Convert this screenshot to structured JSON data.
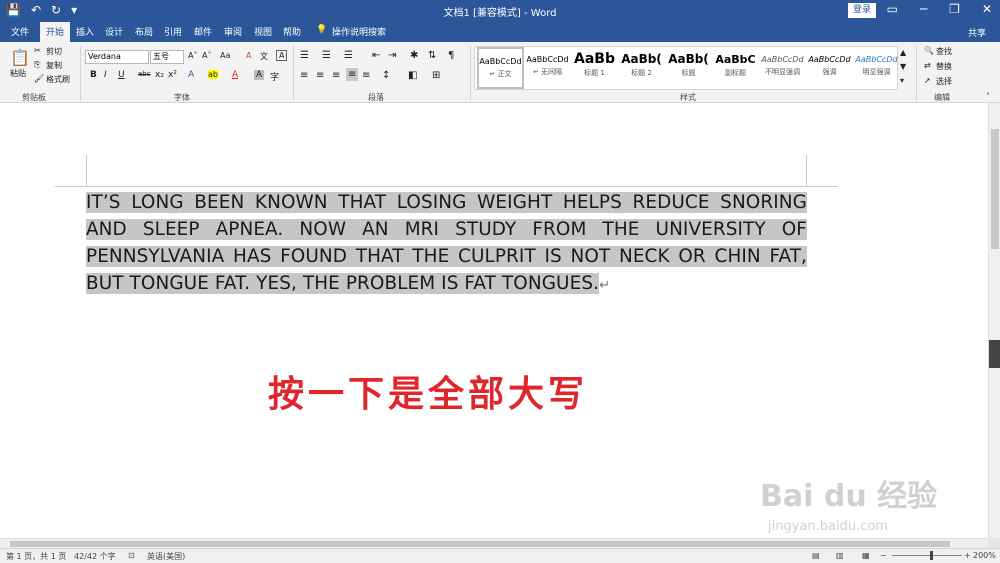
{
  "titlebar": {
    "doc_title": "文档1 [兼容模式] - Word",
    "login": "登录",
    "qat": {
      "save": "💾",
      "undo": "↶",
      "redo": "↻",
      "more": "▾"
    },
    "win": {
      "ribbon_opts": "▭",
      "minimize": "─",
      "restore": "❐",
      "close": "✕"
    }
  },
  "tabs": {
    "items": [
      "文件",
      "开始",
      "插入",
      "设计",
      "布局",
      "引用",
      "邮件",
      "审阅",
      "视图",
      "帮助"
    ],
    "tell_me": "操作说明搜索",
    "share": "共享"
  },
  "ribbon": {
    "clipboard": {
      "paste": "粘贴",
      "cut": "剪切",
      "copy": "复制",
      "format_painter": "格式刷",
      "label": "剪贴板"
    },
    "font": {
      "font_name": "Verdana",
      "font_size": "五号",
      "grow": "A˄",
      "shrink": "A˅",
      "case": "Aa",
      "clear": "A",
      "phonetic": "文",
      "border": "A",
      "bold": "B",
      "italic": "I",
      "underline": "U",
      "strike": "abc",
      "sub": "x₂",
      "sup": "x²",
      "effects": "A",
      "highlight": "ab",
      "color": "A",
      "shade": "A",
      "enclosed": "字",
      "label": "字体"
    },
    "paragraph": {
      "label": "段落"
    },
    "styles": {
      "label": "样式",
      "items": [
        {
          "sample": "AaBbCcDd",
          "name": "↵ 正文"
        },
        {
          "sample": "AaBbCcDd",
          "name": "↵ 无间隔"
        },
        {
          "sample": "AaBb",
          "name": "标题 1"
        },
        {
          "sample": "AaBb(",
          "name": "标题 2"
        },
        {
          "sample": "AaBb(",
          "name": "标题"
        },
        {
          "sample": "AaBbC",
          "name": "副标题"
        },
        {
          "sample": "AaBbCcDd",
          "name": "不明显强调"
        },
        {
          "sample": "AaBbCcDd",
          "name": "强调"
        },
        {
          "sample": "AaBbCcDd",
          "name": "明显强调"
        }
      ]
    },
    "editing": {
      "find": "查找",
      "replace": "替换",
      "select": "选择",
      "label": "编辑"
    }
  },
  "document": {
    "paragraph": " IT’S LONG BEEN KNOWN THAT LOSING WEIGHT HELPS REDUCE SNORING AND SLEEP APNEA. NOW AN MRI STUDY FROM THE UNIVERSITY OF PENNSYLVANIA HAS FOUND THAT THE CULPRIT IS NOT NECK OR CHIN FAT, BUT TONGUE FAT. YES, THE PROBLEM IS FAT TONGUES.",
    "para_mark": "↵",
    "caption": "按一下是全部大写",
    "watermark_main": "Bai du 经验",
    "watermark_sub": "jingyan.baidu.com"
  },
  "statusbar": {
    "page": "第 1 页，共 1 页",
    "words": "42/42 个字",
    "language": "英语(美国)",
    "zoom": "200%"
  },
  "colors": {
    "word_blue": "#2b579a",
    "caption_red": "#e0262b",
    "selection": "#c6c6c6"
  }
}
